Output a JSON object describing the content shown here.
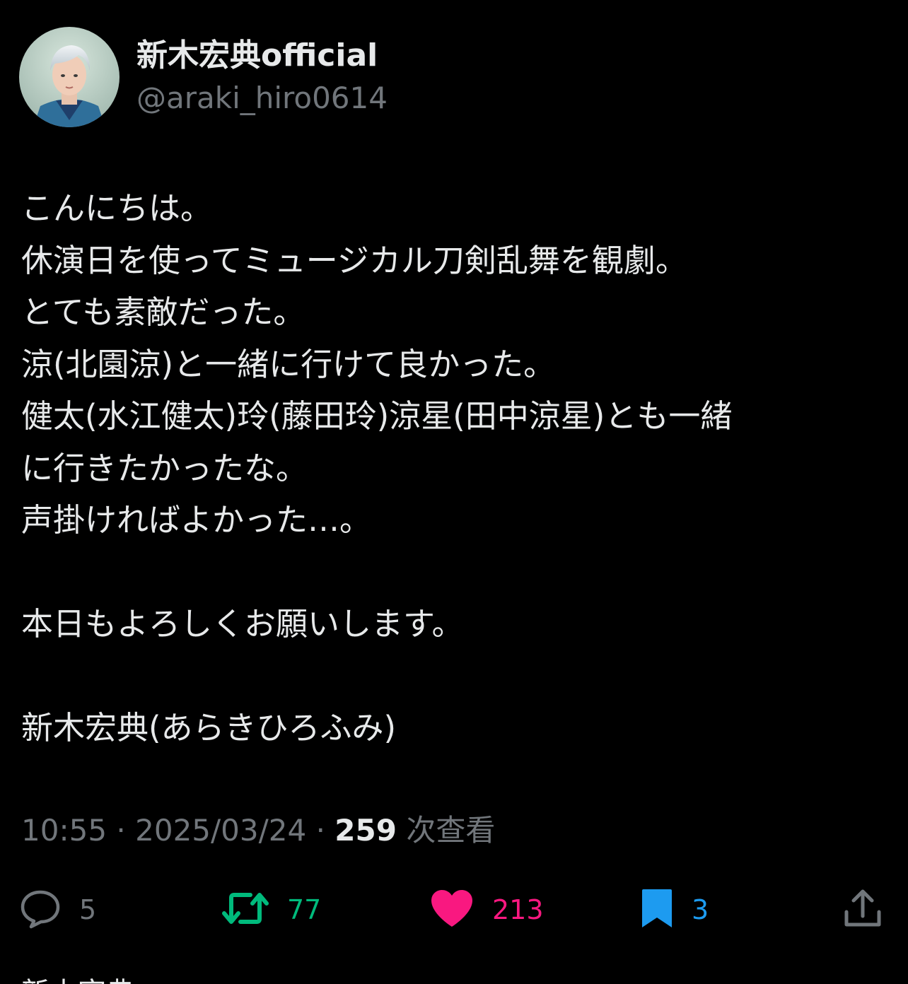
{
  "user": {
    "display_name": "新木宏典official",
    "handle": "@araki_hiro0614",
    "avatar_alt": "avatar"
  },
  "tweet": {
    "lines": [
      "こんにちは。",
      "休演日を使ってミュージカル刀剣乱舞を観劇。",
      "とても素敵だった。",
      "涼(北園涼)と一緒に行けて良かった。",
      "健太(水江健太)玲(藤田玲)涼星(田中涼星)とも一緒",
      "に行きたかったな。",
      "声掛ければよかった…。",
      "",
      "本日もよろしくお願いします。",
      "",
      "新木宏典(あらきひろふみ)"
    ]
  },
  "meta": {
    "time": "10:55",
    "separator": "·",
    "date": "2025/03/24",
    "views_count": "259",
    "views_label": "次查看"
  },
  "actions": {
    "reply": {
      "icon": "reply-icon",
      "count": "5"
    },
    "retweet": {
      "icon": "retweet-icon",
      "count": "77"
    },
    "like": {
      "icon": "heart-icon",
      "count": "213"
    },
    "bookmark": {
      "icon": "bookmark-icon",
      "count": "3"
    },
    "share": {
      "icon": "share-icon"
    }
  },
  "colors": {
    "background": "#000000",
    "text_primary": "#e7e9ea",
    "text_secondary": "#71767b",
    "retweet_green": "#00ba7c",
    "like_pink": "#f91880",
    "bookmark_blue": "#1d9bf0"
  },
  "next_item": {
    "partial_text": "新木宏典"
  }
}
